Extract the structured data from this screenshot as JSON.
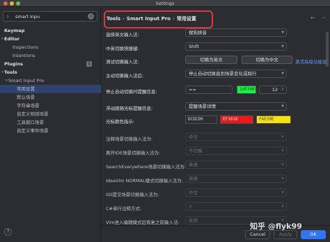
{
  "window": {
    "title": "Settings"
  },
  "sidebar": {
    "search_value": "smart inpu",
    "tree": [
      {
        "label": "Keymap",
        "bold": true,
        "arrow": "",
        "badge": ""
      },
      {
        "label": "Editor",
        "bold": true,
        "arrow": "▾",
        "badge": ""
      },
      {
        "label": "Inspections",
        "bold": false,
        "arrow": "",
        "badge": ""
      },
      {
        "label": "Intentions",
        "bold": false,
        "arrow": "",
        "badge": ""
      },
      {
        "label": "Plugins",
        "bold": true,
        "arrow": "",
        "badge": "1"
      },
      {
        "label": "Tools",
        "bold": true,
        "arrow": "▾",
        "badge": ""
      },
      {
        "label": "Smart Input Pro",
        "bold": false,
        "arrow": "▾",
        "badge": ""
      },
      {
        "label": "常用设置",
        "bold": false,
        "arrow": "",
        "badge": "",
        "selected": true
      },
      {
        "label": "默认场景",
        "bold": false,
        "arrow": "",
        "badge": ""
      },
      {
        "label": "字符串场景",
        "bold": false,
        "arrow": "",
        "badge": ""
      },
      {
        "label": "自定义规则场景",
        "bold": false,
        "arrow": "",
        "badge": ""
      },
      {
        "label": "工具窗口场景",
        "bold": false,
        "arrow": "",
        "badge": ""
      },
      {
        "label": "自定义事件场景",
        "bold": false,
        "arrow": "",
        "badge": ""
      }
    ]
  },
  "breadcrumb": {
    "part1": "Tools",
    "part2": "Smart Input Pro",
    "part3": "常用设置"
  },
  "settings": {
    "english_ime_label": "选择英文输入法:",
    "english_ime_value": "搜狗拼音",
    "switch_key_label": "中英切换快捷键:",
    "switch_key_value": "Shift",
    "test_switch_label": "测试切换输入法:",
    "test_en_button": "切换为英文",
    "test_cn_button": "切换为中文",
    "activate_link": "激活高级功能说",
    "active_switch_label": "主动切换输入法后:",
    "active_switch_value": "停止自动切换直到场景变化或跨行",
    "stop_auto_label": "停止自动切换时提醒信息:",
    "stop_auto_eq": "==",
    "stop_auto_color": "14F340",
    "stop_auto_size": "12",
    "follow_cursor_label": "浮动跟随光标提醒信息:",
    "follow_cursor_value": "提醒场景详情",
    "cursor_color_label": "光标颜色指示:",
    "cursor_color_1": "DCDCD9",
    "cursor_color_2": "EF1616",
    "cursor_color_3": "F6E30E",
    "comment_label": "注释场景切换输入法为:",
    "comment_value": "中文",
    "leave_ide_label": "离开IDE场景切换输入法为:",
    "leave_ide_value": "不切换",
    "search_everywhere_label": "SearchEverywhere场景切换输入法为:",
    "search_everywhere_value": "英语",
    "ideavim_label": "IdeaVim NORMAL模式切换输入法为:",
    "ideavim_value": "英语",
    "git_label": "Git提交场景切换输入法为:",
    "git_value": "中文",
    "csharp_label": "C#单行注释方式:",
    "csharp_value": "//",
    "vim_exit_label": "Vim进入编辑模式后恢复之前输入法:",
    "vim_exit_value": "关闭"
  },
  "footer": {
    "cancel": "Cancel",
    "apply": "Apply",
    "ok": "OK",
    "help": "?"
  },
  "watermark": "知乎 @flyk99",
  "colors": {
    "accent": "#3574f0",
    "highlight_border": "#e0373c",
    "swatch_green": "#14f340",
    "swatch_gray": "#dcdcd9",
    "swatch_red": "#ef1616",
    "swatch_yellow": "#f6e30e"
  }
}
